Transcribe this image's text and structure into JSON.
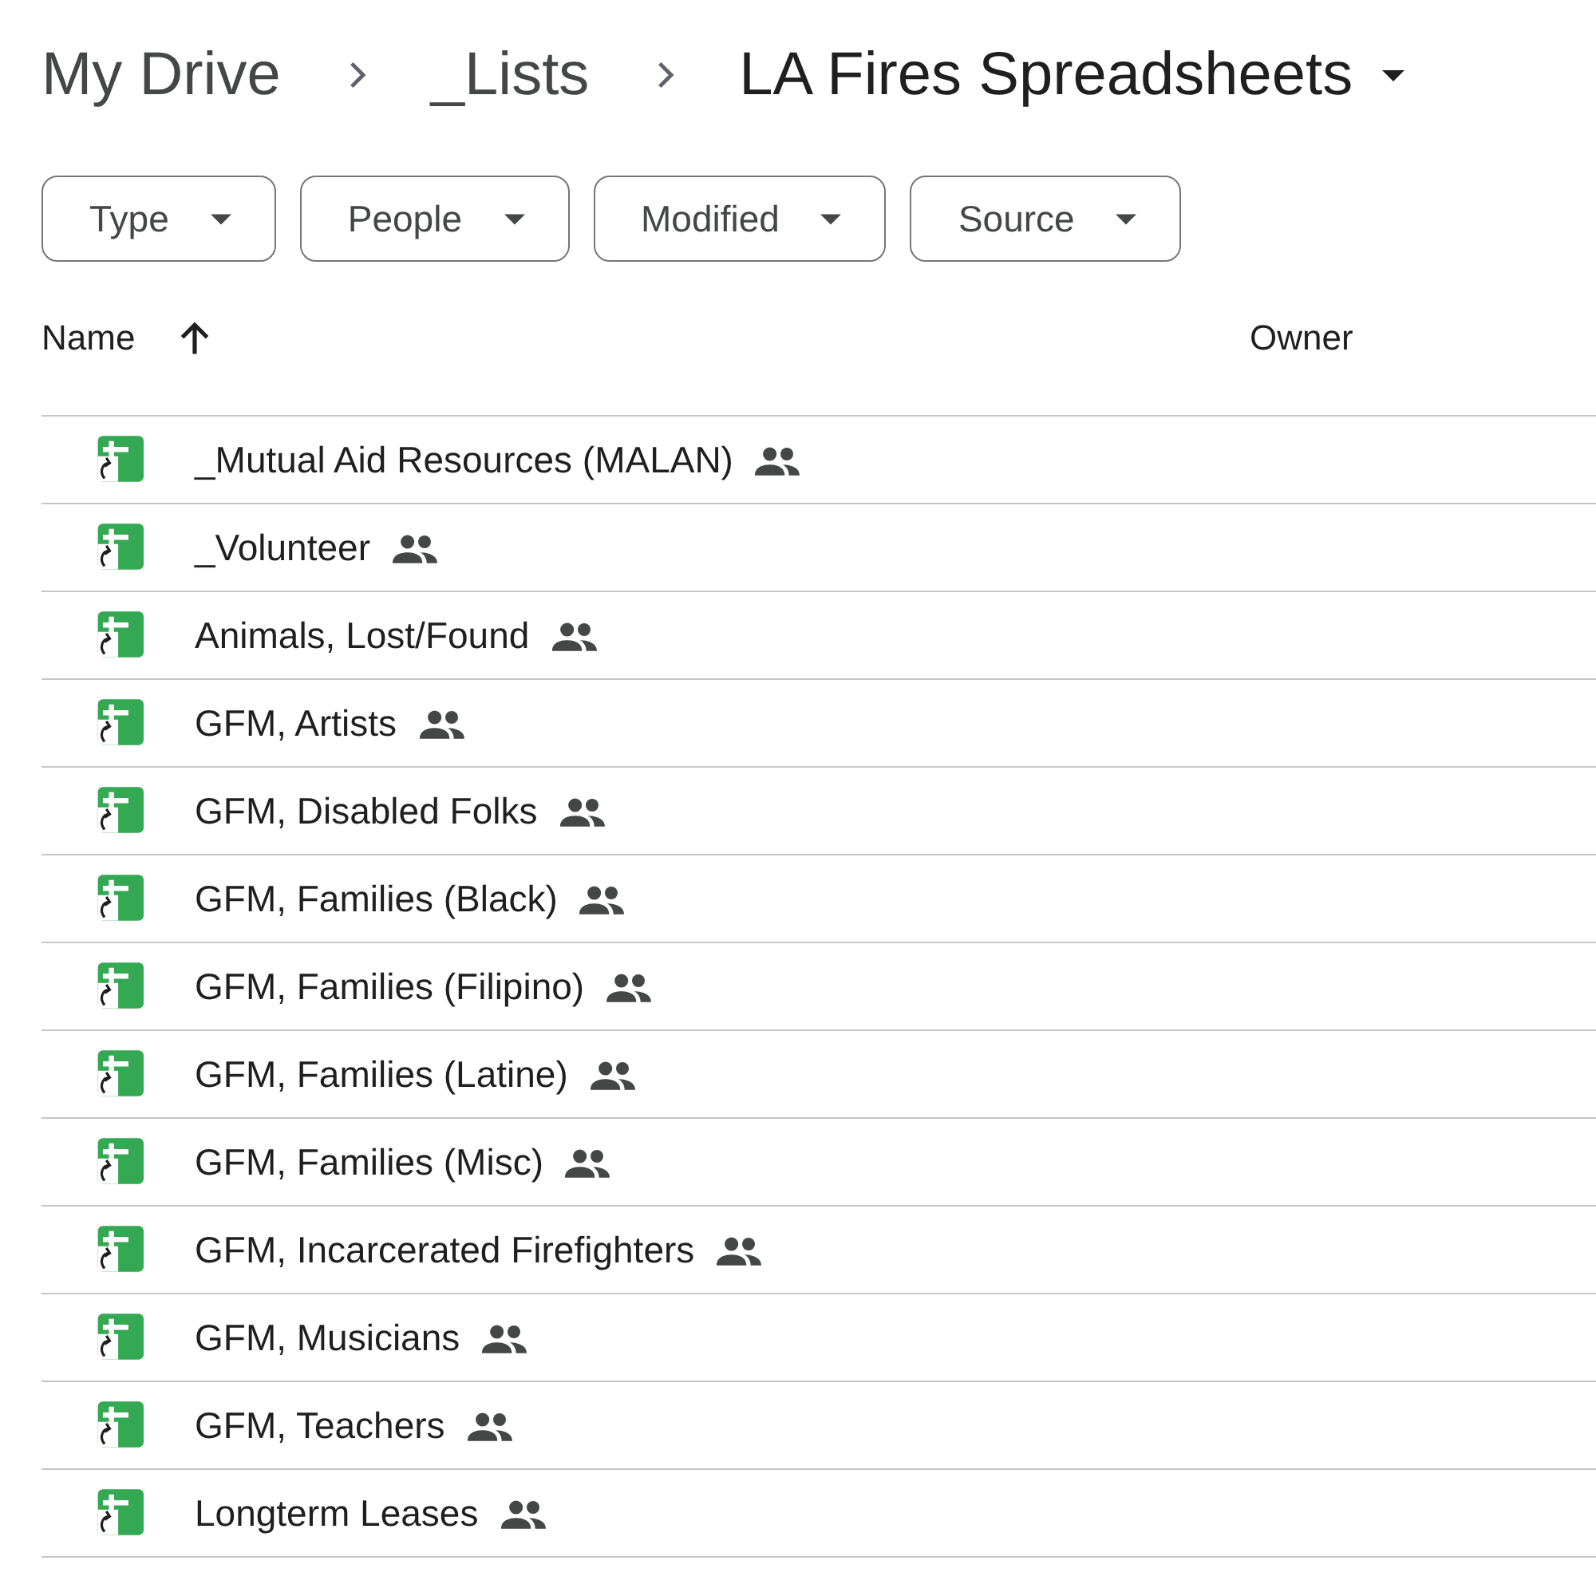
{
  "breadcrumb": [
    {
      "label": "My Drive"
    },
    {
      "label": "_Lists"
    },
    {
      "label": "LA Fires Spreadsheets",
      "current": true
    }
  ],
  "filters": [
    {
      "label": "Type"
    },
    {
      "label": "People"
    },
    {
      "label": "Modified"
    },
    {
      "label": "Source"
    }
  ],
  "table": {
    "columns": [
      {
        "label": "Name",
        "sort_ascending": true
      },
      {
        "label": "Owner"
      }
    ],
    "rows": [
      {
        "name": "_Mutual Aid Resources (MALAN)",
        "shared": true
      },
      {
        "name": "_Volunteer",
        "shared": true
      },
      {
        "name": "Animals, Lost/Found",
        "shared": true
      },
      {
        "name": "GFM, Artists",
        "shared": true
      },
      {
        "name": "GFM, Disabled Folks",
        "shared": true
      },
      {
        "name": "GFM, Families (Black)",
        "shared": true
      },
      {
        "name": "GFM, Families (Filipino)",
        "shared": true
      },
      {
        "name": "GFM, Families (Latine)",
        "shared": true
      },
      {
        "name": "GFM, Families (Misc)",
        "shared": true
      },
      {
        "name": "GFM, Incarcerated Firefighters",
        "shared": true
      },
      {
        "name": "GFM, Musicians",
        "shared": true
      },
      {
        "name": "GFM, Teachers",
        "shared": true
      },
      {
        "name": "Longterm Leases",
        "shared": true
      }
    ]
  }
}
